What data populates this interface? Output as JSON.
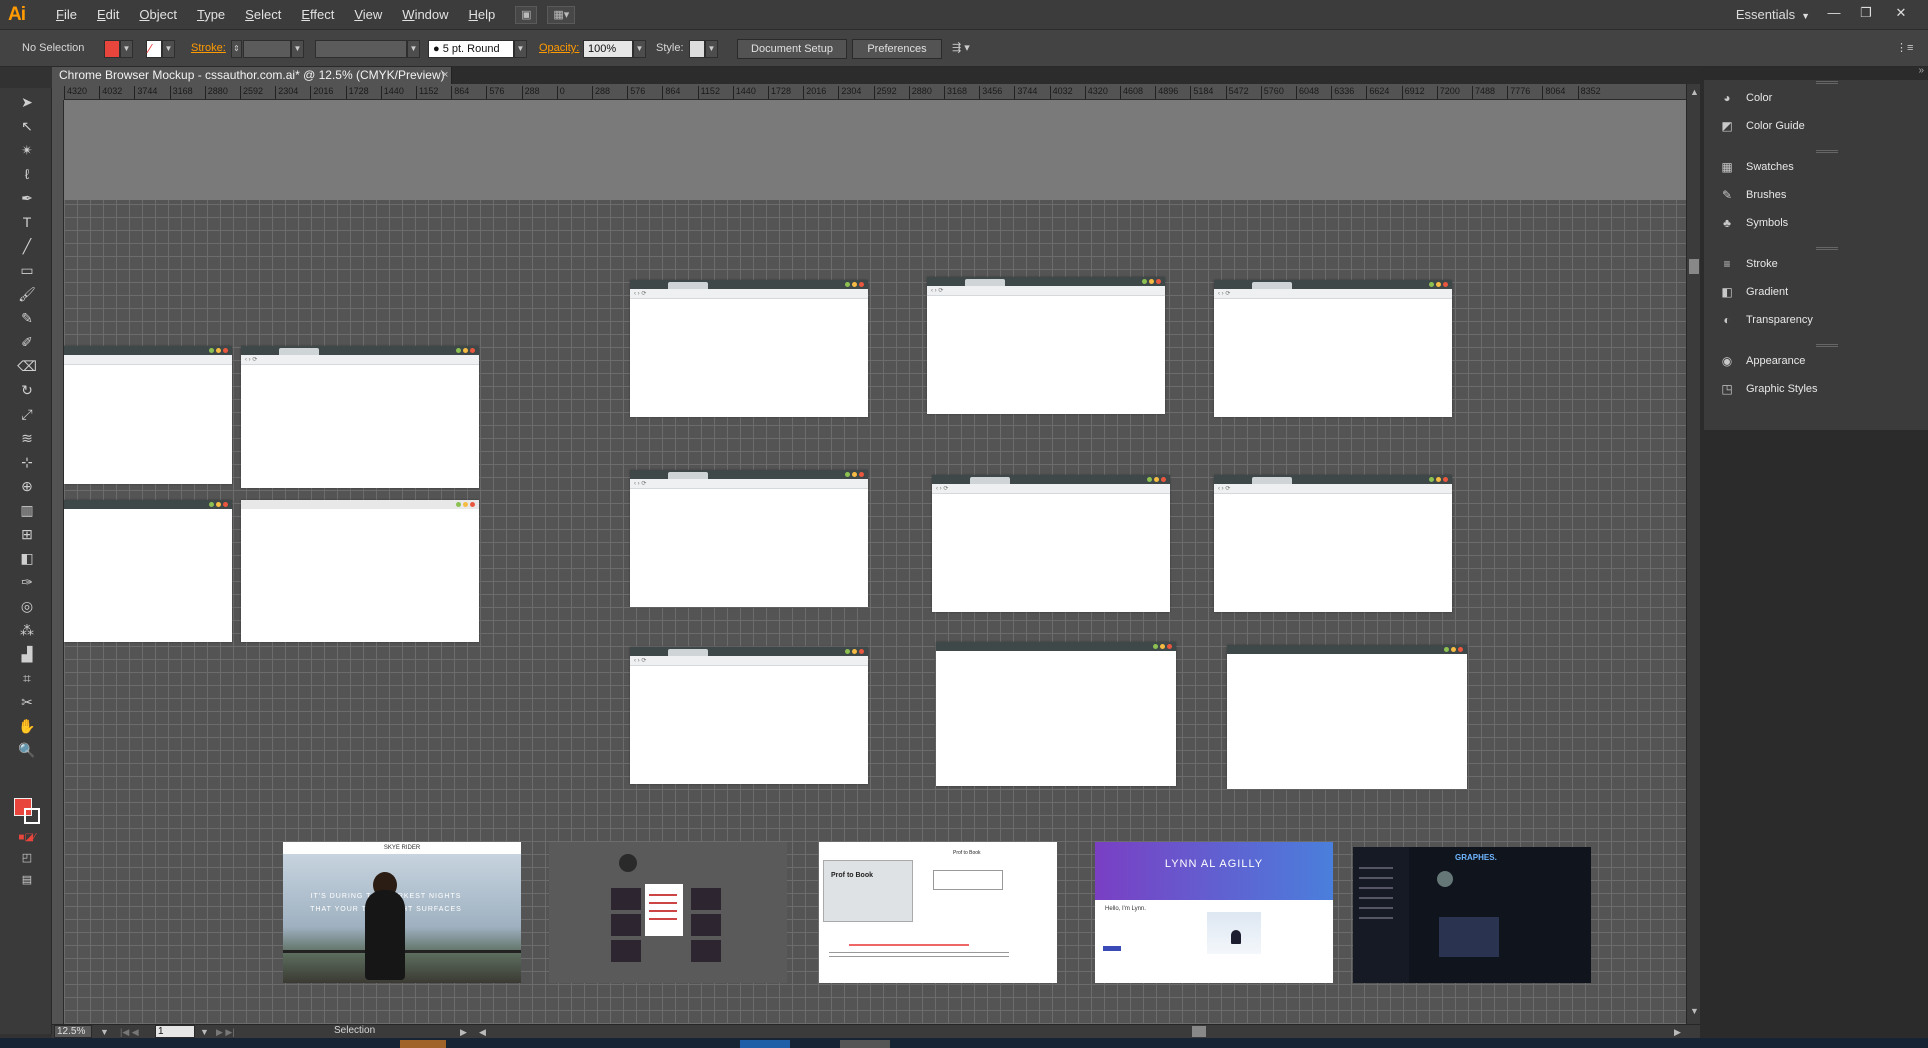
{
  "app": {
    "logo": "Ai",
    "workspace": "Essentials"
  },
  "menu": [
    "File",
    "Edit",
    "Object",
    "Type",
    "Select",
    "Effect",
    "View",
    "Window",
    "Help"
  ],
  "control": {
    "selection": "No Selection",
    "stroke_label": "Stroke:",
    "brush": "5 pt. Round",
    "opacity_label": "Opacity:",
    "opacity": "100%",
    "style_label": "Style:",
    "document_setup": "Document Setup",
    "preferences": "Preferences",
    "fill_color": "#e8453c"
  },
  "document": {
    "tab_title": "Chrome Browser Mockup - cssauthor.com.ai* @ 12.5% (CMYK/Preview)",
    "close": "×"
  },
  "ruler": [
    "4320",
    "4032",
    "3744",
    "3168",
    "2880",
    "2592",
    "2304",
    "2016",
    "1728",
    "1440",
    "1152",
    "864",
    "576",
    "288",
    "0",
    "288",
    "576",
    "864",
    "1152",
    "1440",
    "1728",
    "2016",
    "2304",
    "2592",
    "2880",
    "3168",
    "3456",
    "3744",
    "4032",
    "4320",
    "4608",
    "4896",
    "5184",
    "5472",
    "5760",
    "6048",
    "6336",
    "6624",
    "6912",
    "7200",
    "7488",
    "7776",
    "8064",
    "8352"
  ],
  "thumbnails": {
    "skye_title": "SKYE RIDER",
    "skye_headline": "IT'S DURING THE DARKEST NIGHTS THAT YOUR TRUE LIGHT SURFACES",
    "prof_title": "Prof to Book",
    "lynn_name": "LYNN AL AGILLY",
    "lynn_hello": "Hello, I'm Lynn.",
    "dark_logo": "GRAPHES."
  },
  "panels": [
    "Color",
    "Color Guide",
    "Swatches",
    "Brushes",
    "Symbols",
    "Stroke",
    "Gradient",
    "Transparency",
    "Appearance",
    "Graphic Styles"
  ],
  "status": {
    "zoom": "12.5%",
    "page": "1",
    "tool": "Selection"
  }
}
